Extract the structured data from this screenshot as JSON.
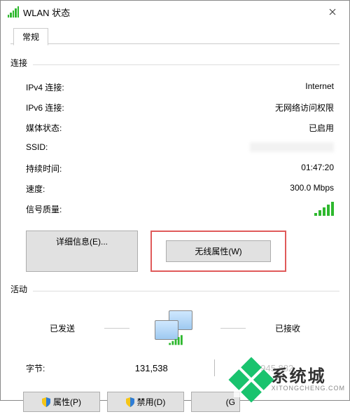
{
  "titlebar": {
    "title": "WLAN 状态"
  },
  "tabs": {
    "general": "常规"
  },
  "section_connection": {
    "label": "连接",
    "ipv4_k": "IPv4 连接:",
    "ipv4_v": "Internet",
    "ipv6_k": "IPv6 连接:",
    "ipv6_v": "无网络访问权限",
    "media_k": "媒体状态:",
    "media_v": "已启用",
    "ssid_k": "SSID:",
    "ssid_v": "",
    "duration_k": "持续时间:",
    "duration_v": "01:47:20",
    "speed_k": "速度:",
    "speed_v": "300.0 Mbps",
    "quality_k": "信号质量:"
  },
  "buttons": {
    "details": "详细信息(E)...",
    "wireless_props": "无线属性(W)"
  },
  "section_activity": {
    "label": "活动",
    "sent": "已发送",
    "received": "已接收",
    "bytes_label": "字节:",
    "bytes_sent": "131,538",
    "bytes_received": "945,882"
  },
  "bottom": {
    "properties": "属性(P)",
    "disable": "禁用(D)",
    "diagnose_partial": "(G"
  },
  "watermark": {
    "name": "系统城",
    "url": "XITONGCHENG.COM"
  }
}
